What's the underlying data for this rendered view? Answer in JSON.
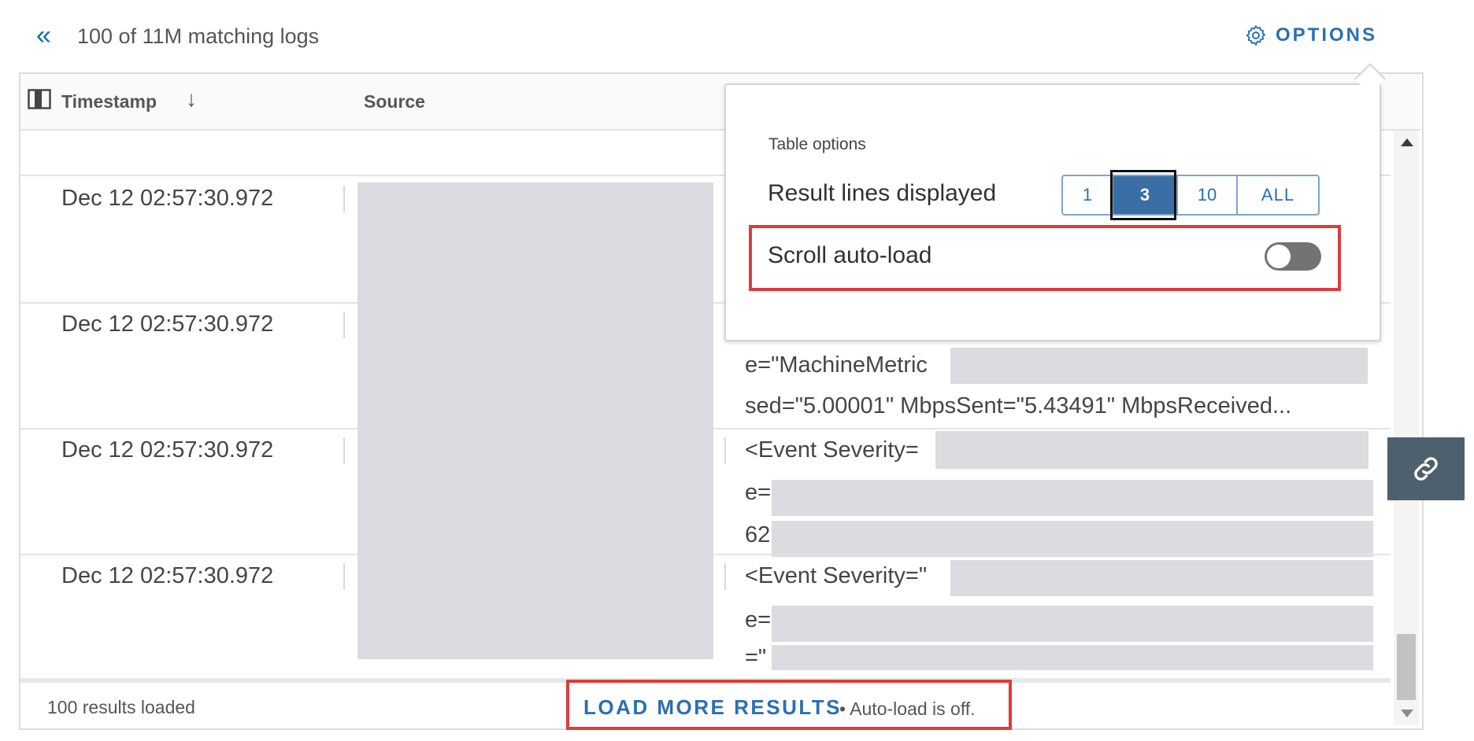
{
  "header": {
    "count_label": "100 of 11M matching logs",
    "options_label": "OPTIONS"
  },
  "table": {
    "columns": [
      "Timestamp",
      "Source"
    ],
    "rows": [
      {
        "timestamp": "Dec 12 02:57:30.972",
        "lines": [
          "",
          "",
          ""
        ]
      },
      {
        "timestamp": "Dec 12 02:57:30.972",
        "lines": [
          "",
          "e=\"MachineMetric",
          "sed=\"5.00001\" MbpsSent=\"5.43491\" MbpsReceived..."
        ]
      },
      {
        "timestamp": "Dec 12 02:57:30.972",
        "lines": [
          "<Event Severity=",
          "e=",
          "62"
        ]
      },
      {
        "timestamp": "Dec 12 02:57:30.972",
        "lines": [
          "<Event Severity=\"",
          "e=",
          "=\""
        ]
      }
    ]
  },
  "footer": {
    "results_loaded": "100 results loaded",
    "load_more": "LOAD MORE RESULTS",
    "autoload_note": "• Auto-load is off."
  },
  "options_popup": {
    "title": "Table options",
    "result_lines_label": "Result lines displayed",
    "result_lines_options": [
      "1",
      "3",
      "10",
      "ALL"
    ],
    "result_lines_selected": "3",
    "scroll_autoload_label": "Scroll auto-load",
    "scroll_autoload_on": false
  },
  "colors": {
    "accent": "#2a6fb3",
    "selected_segment": "#3a6ea5",
    "highlight_box": "#e03a3a",
    "redaction": "#dcdce0"
  }
}
